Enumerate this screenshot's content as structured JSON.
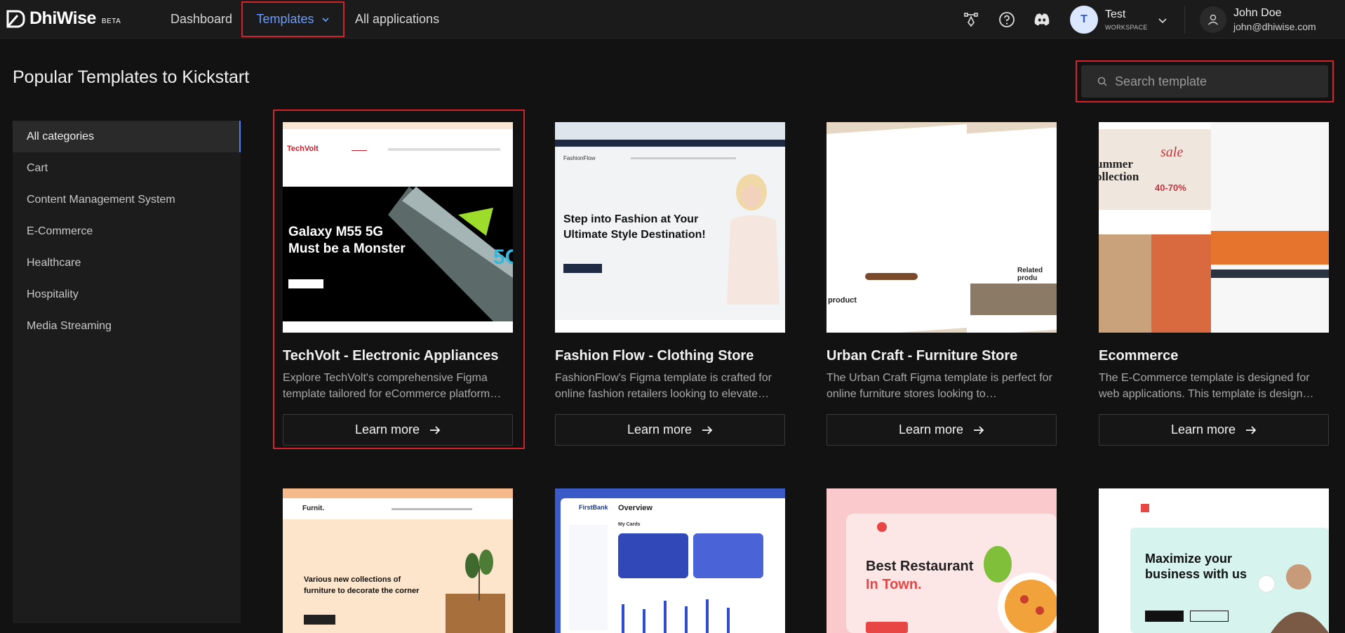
{
  "header": {
    "logo_text": "DhiWise",
    "logo_badge": "BETA",
    "nav": {
      "dashboard": "Dashboard",
      "templates": "Templates",
      "all_applications": "All applications"
    },
    "workspace": {
      "initial": "T",
      "name": "Test",
      "label": "WORKSPACE"
    },
    "user": {
      "name": "John Doe",
      "email": "john@dhiwise.com"
    }
  },
  "page": {
    "title": "Popular Templates to Kickstart",
    "search_placeholder": "Search template"
  },
  "categories": [
    "All categories",
    "Cart",
    "Content Management System",
    "E-Commerce",
    "Healthcare",
    "Hospitality",
    "Media Streaming"
  ],
  "learn_more_label": "Learn more",
  "templates": [
    {
      "title": "TechVolt - Electronic Appliances",
      "desc": "Explore TechVolt's comprehensive Figma template tailored for eCommerce platform…",
      "thumb": {
        "brand": "TechVolt",
        "headline1": "Galaxy M55 5G",
        "headline2": "Must be a Monster"
      }
    },
    {
      "title": "Fashion Flow - Clothing Store",
      "desc": "FashionFlow's Figma template is crafted for online fashion retailers looking to elevate…",
      "thumb": {
        "brand": "FashionFlow",
        "headline1": "Step into Fashion at Your",
        "headline2": "Ultimate Style Destination!"
      }
    },
    {
      "title": "Urban Craft - Furniture Store",
      "desc": "The Urban Craft Figma template is perfect for online furniture stores looking to…",
      "thumb": {
        "headline1": "Related produ",
        "headline2": "product"
      }
    },
    {
      "title": "Ecommerce",
      "desc": "The E-Commerce template is designed for web applications. This template is design…",
      "thumb": {
        "headline1": "ummer",
        "headline2": "ollection",
        "sale": "sale",
        "pct": "40-70%"
      }
    },
    {
      "title": "",
      "desc": "",
      "thumb": {
        "brand": "Furnit.",
        "headline1": "Various new collections of",
        "headline2": "furniture to decorate the corner"
      }
    },
    {
      "title": "",
      "desc": "",
      "thumb": {
        "brand": "FirstBank",
        "headline1": "Overview",
        "headline2": "My Cards"
      }
    },
    {
      "title": "",
      "desc": "",
      "thumb": {
        "headline1": "Best Restaurant",
        "headline2": "In Town."
      }
    },
    {
      "title": "",
      "desc": "",
      "thumb": {
        "headline1": "Maximize your",
        "headline2": "business with us"
      }
    }
  ],
  "colors": {
    "highlight": "#d3222a",
    "accent": "#6a9cff",
    "background": "#121212"
  }
}
